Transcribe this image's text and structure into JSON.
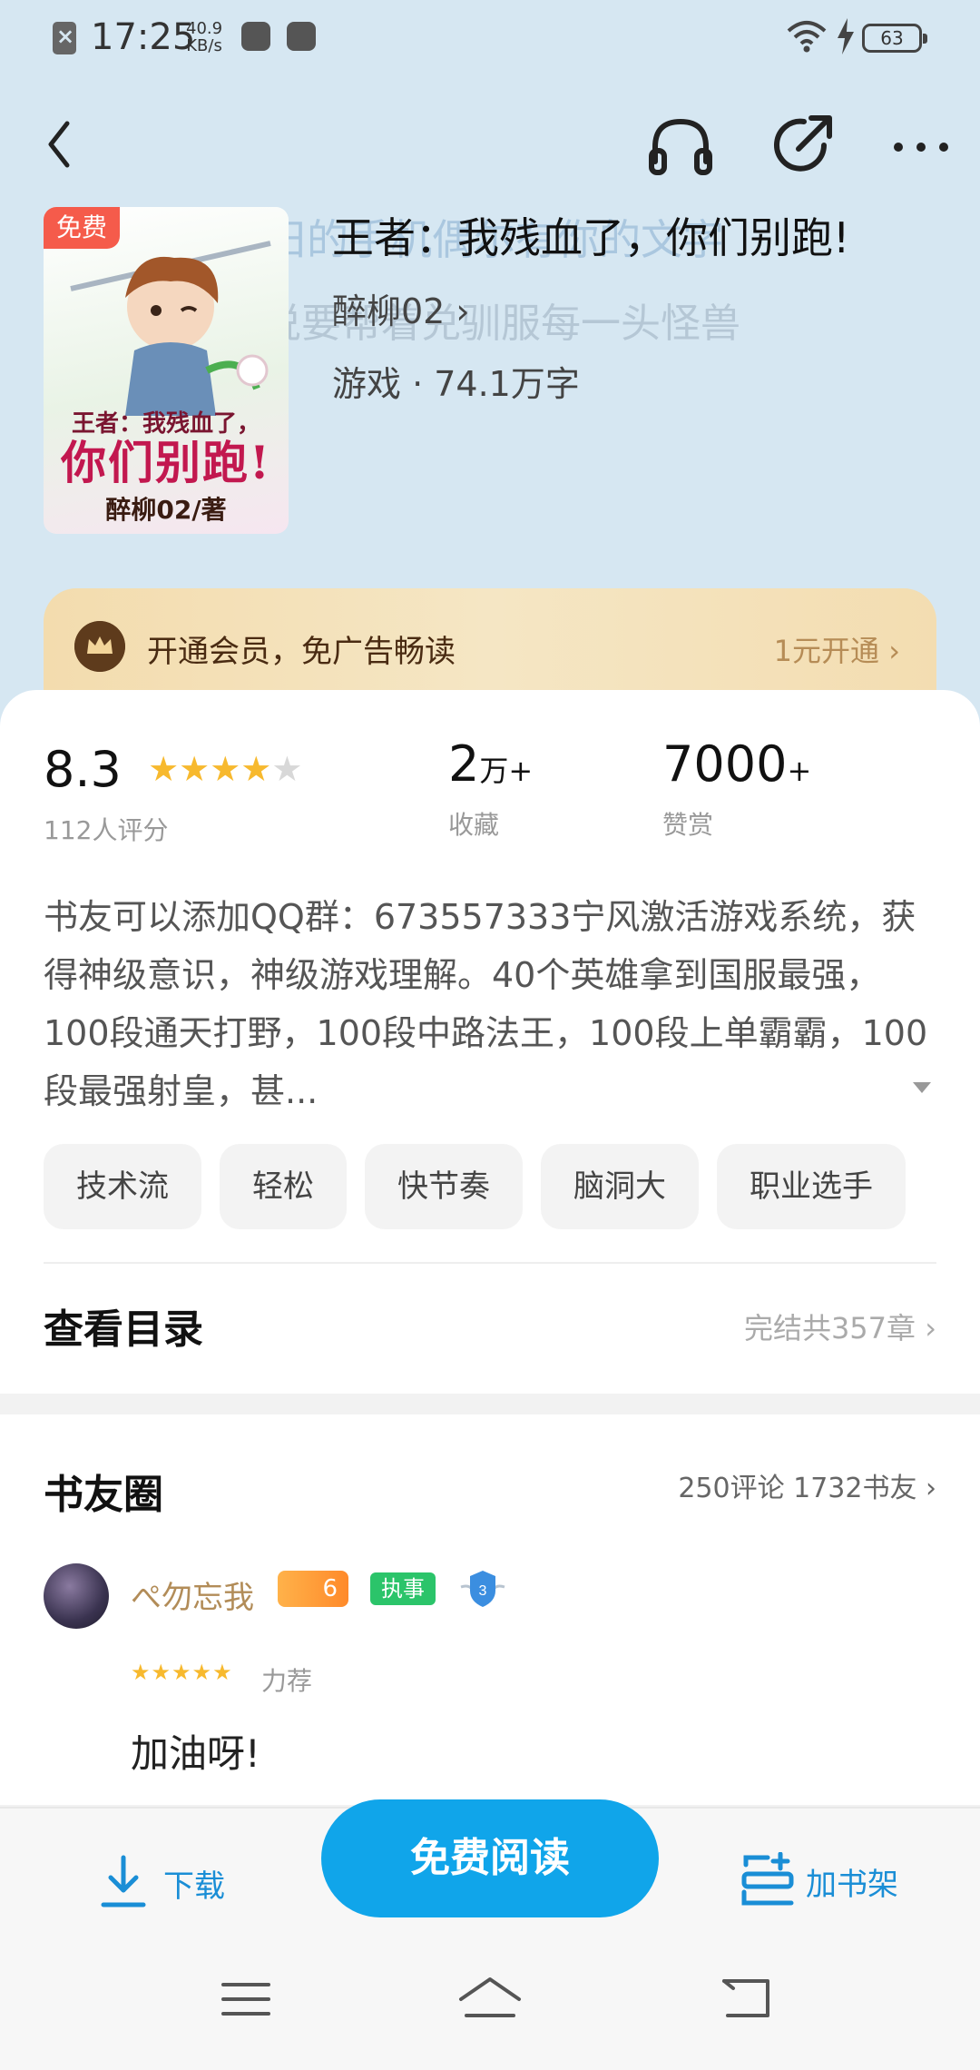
{
  "status_bar": {
    "time": "17:25",
    "speed_value": "40.9",
    "speed_unit": "KB/s",
    "battery": "63"
  },
  "toolbar": {
    "icons": [
      "back-icon",
      "headphones-icon",
      "share-icon",
      "more-icon"
    ]
  },
  "book": {
    "free_badge": "免费",
    "title": "王者：我残血了，你们别跑!",
    "author": "醉柳02 ›",
    "meta": "游戏 · 74.1万字",
    "cover_title_line1": "王者：我残血了，",
    "cover_title_line2": "你们别跑!",
    "cover_author": "醉柳02/著",
    "ghost_line1": "你破旧的手机偶尔有你的文字",
    "ghost_line2": "他们说要帮着兑驯服每一头怪兽"
  },
  "vip": {
    "text": "开通会员，免广告畅读",
    "action": "1元开通 ›"
  },
  "stats": {
    "rating": "8.3",
    "rating_label": "112人评分",
    "rating_stars": 4,
    "favorites_value": "2",
    "favorites_unit": "万+",
    "favorites_label": "收藏",
    "rewards_value": "7000",
    "rewards_unit": "+",
    "rewards_label": "赞赏"
  },
  "description": "书友可以添加QQ群：673557333宁风激活游戏系统，获得神级意识，神级游戏理解。40个英雄拿到国服最强，100段通天打野，100段中路法王，100段上单霸霸，100段最强射皇，甚...",
  "tags": [
    "技术流",
    "轻松",
    "快节奏",
    "脑洞大",
    "职业选手"
  ],
  "toc": {
    "label": "查看目录",
    "info": "完结共357章 ›"
  },
  "community": {
    "title": "书友圈",
    "info": "250评论 1732书友 ›",
    "comment": {
      "username": "ぺ勿忘我",
      "fire_level": "6",
      "role": "执事",
      "shield_level": "3",
      "stars": "★★★★★",
      "recommend": "力荐",
      "text": "加油呀!"
    }
  },
  "bottom_bar": {
    "download": "下载",
    "read": "免费阅读",
    "add_shelf": "加书架"
  },
  "colors": {
    "accent": "#10a5ea",
    "header_bg": "#d6e7f2",
    "star": "#f7b92e",
    "vip_text": "#4a2b12"
  }
}
